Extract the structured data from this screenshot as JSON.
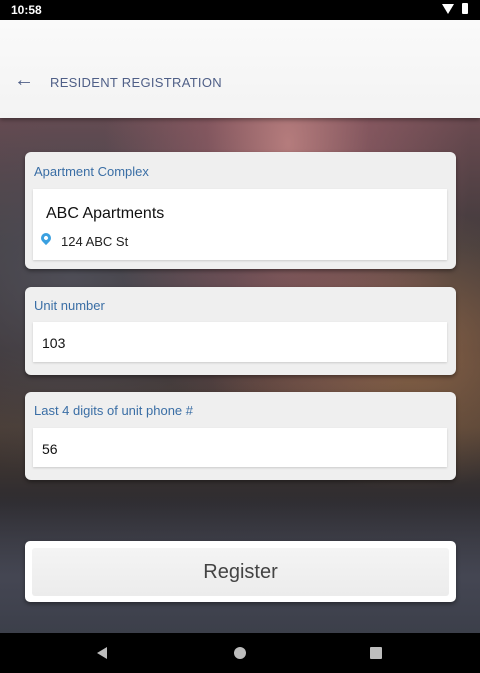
{
  "status_bar": {
    "time": "10:58",
    "icons": [
      "wifi-icon",
      "battery-icon"
    ]
  },
  "app_bar": {
    "back_icon": "←",
    "title": "RESIDENT REGISTRATION"
  },
  "apartment_complex": {
    "label": "Apartment Complex",
    "name": "ABC Apartments",
    "address": "124 ABC St",
    "pin_icon": "location-pin-icon"
  },
  "unit_number": {
    "label": "Unit number",
    "value": "103"
  },
  "phone_digits": {
    "label": "Last 4 digits of unit phone #",
    "value": "56"
  },
  "register": {
    "label": "Register"
  },
  "colors": {
    "accent_label": "#3a6ea5",
    "app_bar_text": "#4f5f87",
    "pin": "#3aa0e0"
  }
}
